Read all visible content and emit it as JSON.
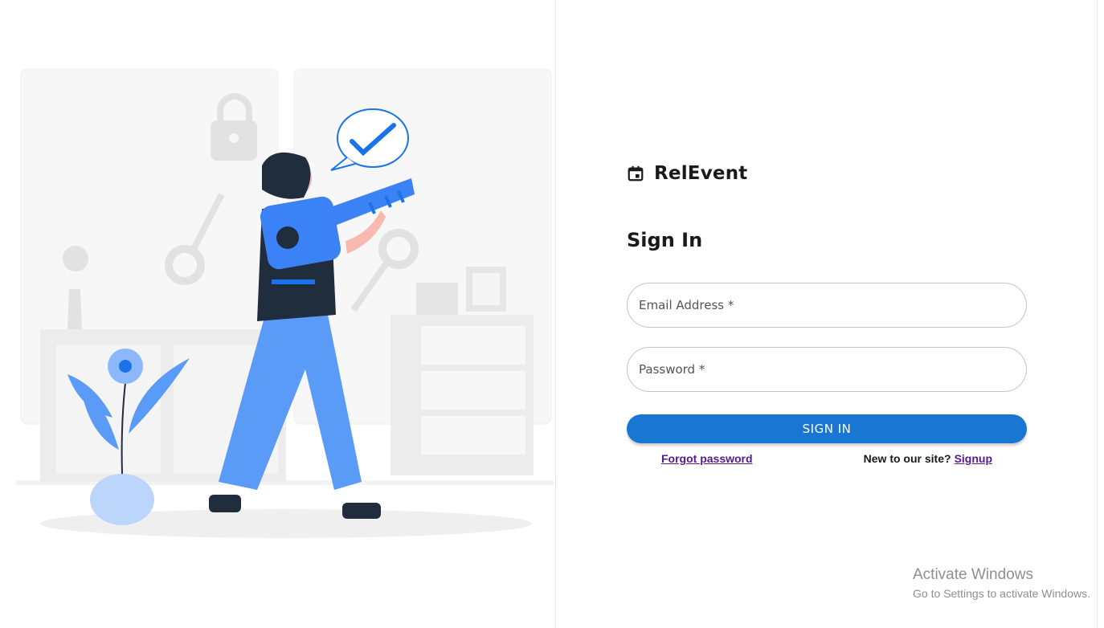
{
  "brand": {
    "name": "RelEvent",
    "icon": "calendar-icon"
  },
  "form": {
    "heading": "Sign In",
    "email_label": "Email Address *",
    "password_label": "Password *",
    "submit_label": "SIGN IN",
    "forgot_label": "Forgot password",
    "new_user_text": "New to our site?",
    "signup_label": "Signup"
  },
  "watermark": {
    "title": "Activate Windows",
    "subtitle": "Go to Settings to activate Windows."
  },
  "colors": {
    "primary": "#1976d2",
    "illustration_blue": "#5b9bf8",
    "link_visited": "#551a8b"
  }
}
